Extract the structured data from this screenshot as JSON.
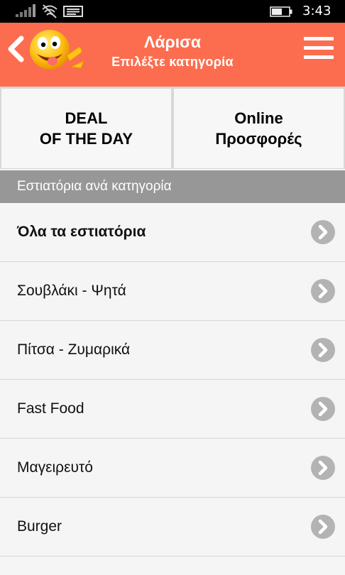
{
  "status_bar": {
    "time": "3:43",
    "icons": [
      "signal-icon",
      "wifi-icon",
      "message-icon",
      "battery-icon"
    ]
  },
  "header": {
    "title": "Λάρισα",
    "subtitle": "Επιλέξτε κατηγορία",
    "background_color": "#fc6d4f",
    "icons": [
      "back-arrow-icon",
      "smiley-logo",
      "hamburger-menu-icon"
    ]
  },
  "tiles": {
    "deal_line1": "DEAL",
    "deal_line2": "OF THE DAY",
    "online_line1": "Online",
    "online_line2": "Προσφορές"
  },
  "section": {
    "title": "Εστιατόρια ανά κατηγορία"
  },
  "categories": [
    {
      "label": "Όλα τα εστιατόρια"
    },
    {
      "label": "Σουβλάκι - Ψητά"
    },
    {
      "label": "Πίτσα - Ζυμαρικά"
    },
    {
      "label": "Fast Food"
    },
    {
      "label": "Μαγειρευτό"
    },
    {
      "label": "Burger"
    }
  ]
}
